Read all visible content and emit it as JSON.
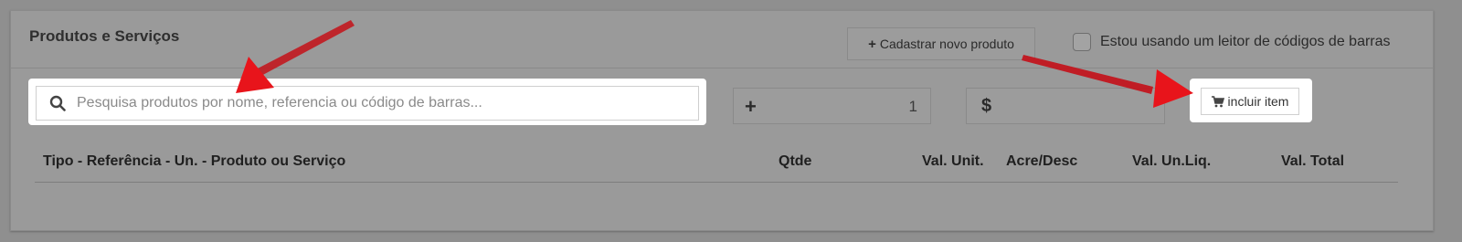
{
  "panel": {
    "title": "Produtos e Serviços",
    "new_product_label": "Cadastrar novo produto",
    "barcode_checkbox_label": "Estou usando um leitor de códigos de barras",
    "barcode_checked": false
  },
  "search": {
    "placeholder": "Pesquisa produtos por nome, referencia ou código de barras...",
    "value": ""
  },
  "quantity": {
    "value": "1",
    "icon": "plus-icon"
  },
  "price": {
    "symbol": "$",
    "value": ""
  },
  "include_button": {
    "label": "incluir item",
    "icon": "cart-icon"
  },
  "table": {
    "columns": [
      "Tipo - Referência - Un. - Produto ou Serviço",
      "Qtde",
      "Val. Unit.",
      "Acre/Desc",
      "Val. Un.Liq.",
      "Val. Total"
    ],
    "rows": []
  },
  "colors": {
    "overlay": "#8f8f8f",
    "highlight": "#ffffff",
    "arrow": "#e8141b"
  }
}
